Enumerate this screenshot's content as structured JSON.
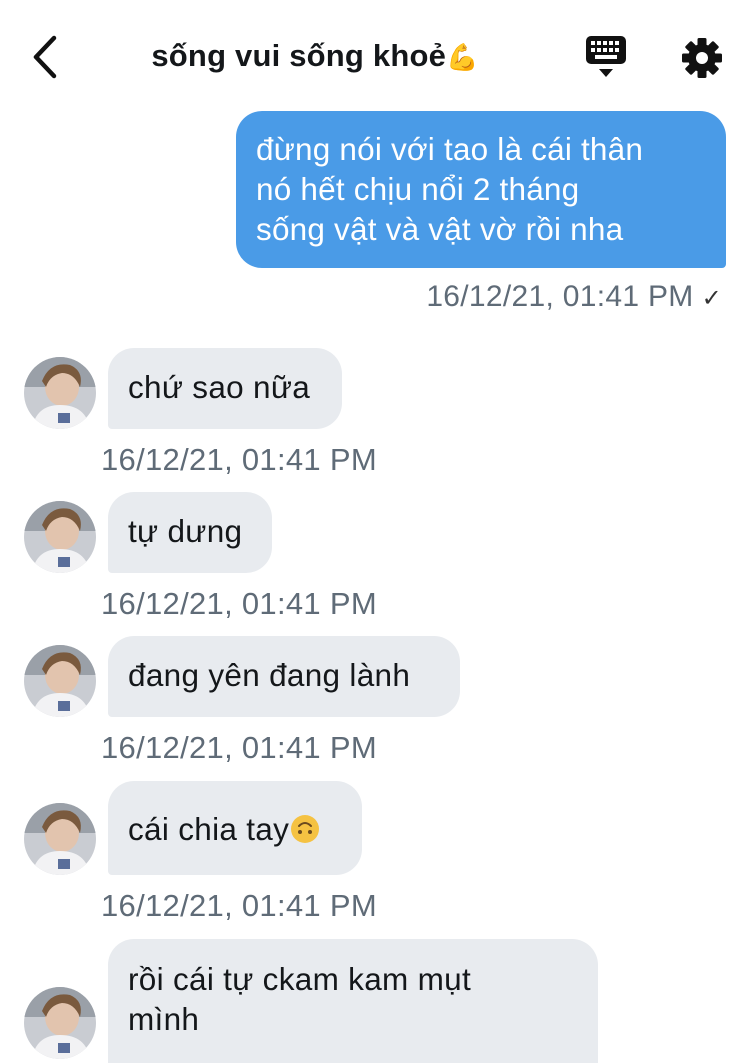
{
  "header": {
    "title": "sống vui sống khoẻ",
    "title_emoji": "💪",
    "back_icon": "chevron-left-icon",
    "keyboard_icon": "keyboard-icon",
    "settings_icon": "gear-icon"
  },
  "colors": {
    "sent_bubble": "#4a9be7",
    "received_bubble": "#e8ebef",
    "timestamp": "#5f6b77"
  },
  "messages": [
    {
      "direction": "sent",
      "lines": [
        "đừng nói với tao là cái thân",
        "nó hết chịu nổi 2 tháng",
        "sống vật và vật vờ rồi nha"
      ],
      "time": "16/12/21, 01:41 PM",
      "status": "✓"
    },
    {
      "direction": "received",
      "text": "chứ sao nữa",
      "time": "16/12/21, 01:41 PM"
    },
    {
      "direction": "received",
      "text": "tự dưng",
      "time": "16/12/21, 01:41 PM"
    },
    {
      "direction": "received",
      "text": "đang yên đang lành",
      "time": "16/12/21, 01:41 PM"
    },
    {
      "direction": "received",
      "text": "cái chia tay",
      "emoji": "upside-down-face-emoji",
      "time": "16/12/21, 01:41 PM"
    },
    {
      "direction": "received",
      "lines": [
        "rồi cái tự ckam kam mụt",
        "mình"
      ]
    }
  ]
}
